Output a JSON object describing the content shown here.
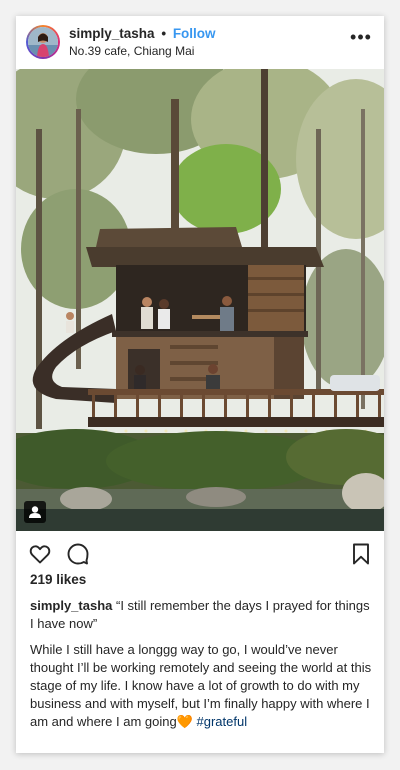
{
  "post": {
    "username": "simply_tasha",
    "follow_label": "Follow",
    "location": "No.39 cafe, Chiang Mai",
    "more_icon": "more-horizontal-icon",
    "likes": "219 likes",
    "caption_quote": "“I still remember the days I prayed for things I have now”",
    "caption_body": "While I still have a longgg way to go, I would’ve never thought I’ll be working remotely and seeing the world at this stage of my life. I know have a lot of growth to do with my business and with myself, but I’m finally happy with where I am and where I am going",
    "emoji": "🧡",
    "hashtag": "#grateful"
  },
  "icons": {
    "like": "heart-icon",
    "comment": "comment-icon",
    "save": "bookmark-icon",
    "user_tag": "user-tag-icon"
  },
  "colors": {
    "follow": "#3897f0",
    "hashtag": "#003569",
    "text": "#262626"
  }
}
